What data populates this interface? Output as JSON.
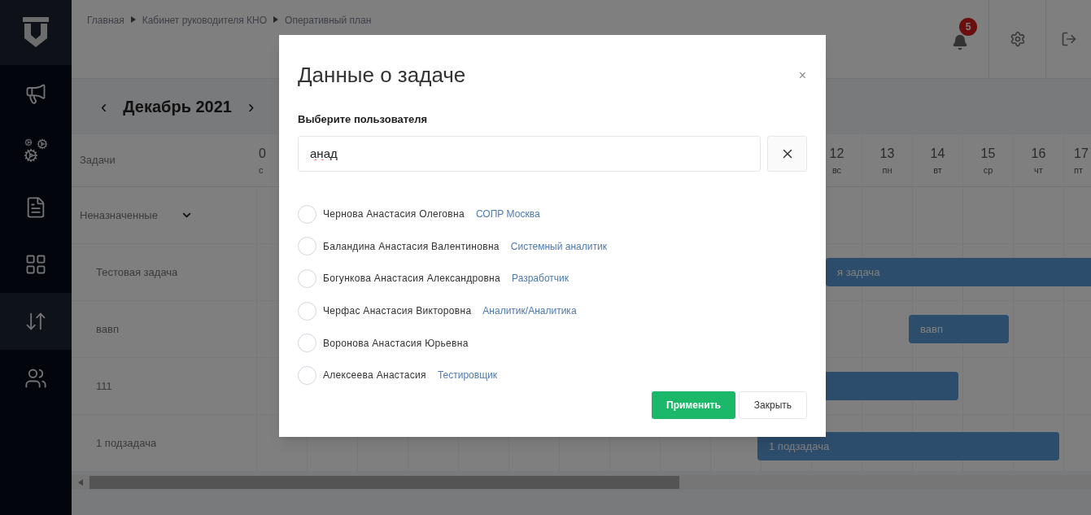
{
  "sidebar": {
    "items": [
      {
        "kind": "megaphone",
        "selected": false
      },
      {
        "kind": "gears",
        "selected": false
      },
      {
        "kind": "document",
        "selected": false
      },
      {
        "kind": "grid",
        "selected": false
      },
      {
        "kind": "arrows",
        "selected": true
      },
      {
        "kind": "users",
        "selected": false
      }
    ]
  },
  "breadcrumbs": [
    "Главная",
    "Кабинет руководителя КНО",
    "Оперативный план"
  ],
  "header": {
    "notifications": "5"
  },
  "month_nav": {
    "prev": "‹",
    "title": "Декабрь 2021",
    "next": "›"
  },
  "gantt": {
    "tasks_header": "Задачи",
    "days": [
      {
        "number": "0",
        "weekday": "с",
        "kind": "first"
      },
      {
        "number": "12",
        "weekday": "вс",
        "kind": "visible"
      },
      {
        "number": "13",
        "weekday": "пн",
        "kind": "visible"
      },
      {
        "number": "14",
        "weekday": "вт",
        "kind": "visible"
      },
      {
        "number": "15",
        "weekday": "ср",
        "kind": "visible"
      },
      {
        "number": "16",
        "weekday": "чт",
        "kind": "visible"
      },
      {
        "number": "17",
        "weekday": "пт",
        "kind": "visible"
      }
    ],
    "group": {
      "label": "Неназначенные",
      "expanded": true
    },
    "rows": [
      {
        "name": "Тестовая задача",
        "has_bar": true,
        "bar_label": "я задача"
      },
      {
        "name": "вавп",
        "has_bar": true,
        "bar_label": "вавп"
      },
      {
        "name": "111",
        "has_bar": true
      },
      {
        "name": "1 подзадача",
        "has_bar": true,
        "bar_label": "1 подзадача"
      }
    ]
  },
  "dialog": {
    "title": "Данные о задаче",
    "close": "×",
    "field_label": "Выберите пользователя",
    "search_value": "анад",
    "users": [
      {
        "name": "Чернова Анастасия Олеговна",
        "role": "СОПР Москва",
        "selected": false
      },
      {
        "name": "Баландина Анастасия Валентиновна",
        "role": "Системный аналитик",
        "selected": false
      },
      {
        "name": "Богункова Анастасия Александровна",
        "role": "Разработчик",
        "selected": false
      },
      {
        "name": "Черфас Анастасия Викторовна",
        "role": "Аналитик/Аналитика",
        "selected": false
      },
      {
        "name": "Воронова Анастасия Юрьевна",
        "selected": false
      },
      {
        "name": "Алексеева Анастасия",
        "role": "Тестировщик",
        "selected": false
      }
    ],
    "buttons": [
      {
        "label": "Применить",
        "kind": "primary"
      },
      {
        "label": "Закрыть",
        "kind": "secondary"
      }
    ]
  }
}
